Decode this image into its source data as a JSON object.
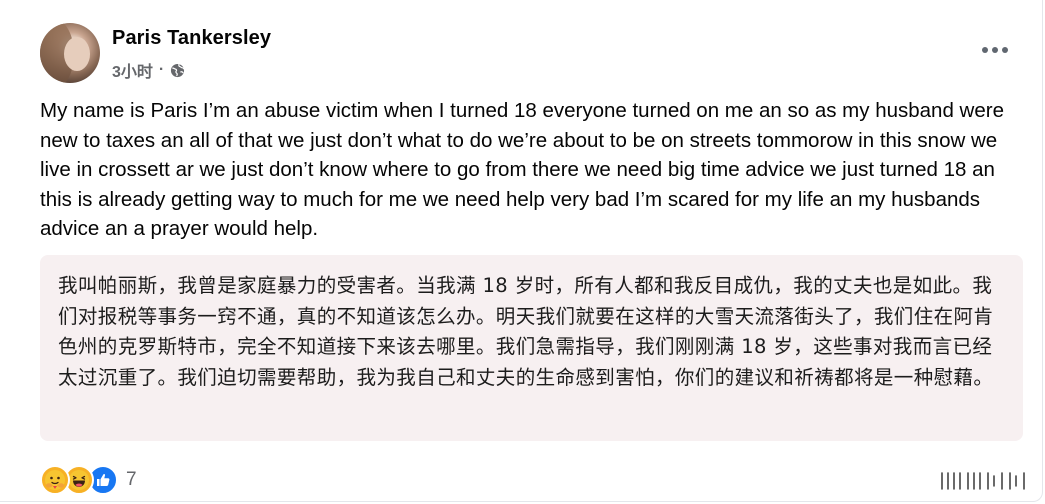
{
  "post": {
    "author": "Paris Tankersley",
    "time": "3小时",
    "separator": "·",
    "visibility_icon": "globe-icon",
    "more_icon": "more-options-icon",
    "text": "My name is Paris I’m an abuse victim when I turned 18 everyone turned on me an so as my husband were new to taxes an all of that we just don’t what to do we’re about to be on streets tommorow in this snow we live in crossett ar we just don’t know where to go from there we need big time advice we just turned 18 an this is already getting way to much for me we need help very bad I’m scared for my life an my husbands advice an a prayer would help.",
    "translation": "我叫帕丽斯，我曾是家庭暴力的受害者。当我满 18 岁时，所有人都和我反目成仇，我的丈夫也是如此。我们对报税等事务一窍不通，真的不知道该怎么办。明天我们就要在这样的大雪天流落街头了，我们住在阿肯色州的克罗斯特市，完全不知道接下来该去哪里。我们急需指导，我们刚刚满 18 岁，这些事对我而言已经太过沉重了。我们迫切需要帮助，我为我自己和丈夫的生命感到害怕，你们的建议和祈祷都将是一种慰藉。"
  },
  "reactions": {
    "icons": [
      "care-icon",
      "haha-icon",
      "like-icon"
    ],
    "count": "7"
  },
  "colors": {
    "meta_gray": "#65676b",
    "translation_bg": "#f7f0f1",
    "like_blue": "#1877f2",
    "emoji_yellow": "#f7b125"
  }
}
